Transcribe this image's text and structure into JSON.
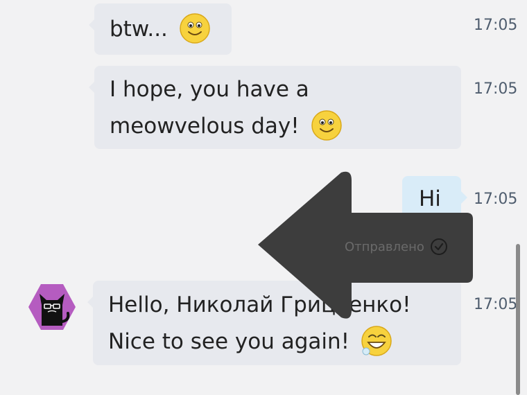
{
  "messages": [
    {
      "text": "btw...",
      "time": "17:05",
      "direction": "in"
    },
    {
      "line1": "I hope, you have a",
      "line2": "meowvelous day!",
      "time": "17:05",
      "direction": "in"
    },
    {
      "text": "Hi",
      "time": "17:05",
      "direction": "out",
      "status": "Отправлено"
    },
    {
      "line1": "Hello, Николай Грицаенко!",
      "line2": "Nice to see you again!",
      "time": "17:05",
      "direction": "in"
    }
  ],
  "icons": {
    "smile": "smile-emoji-icon",
    "grin": "grin-emoji-icon",
    "sent": "sent-check-icon",
    "avatar": "cat-bot-avatar",
    "overlay": "left-arrow-overlay"
  },
  "colors": {
    "background": "#f2f2f3",
    "incoming_bubble": "#e7e9ee",
    "outgoing_bubble": "#d9ecf8",
    "time_text": "#4f5d6e",
    "avatar_hex": "#b55cc0",
    "arrow_overlay": "#3d3d3d"
  }
}
